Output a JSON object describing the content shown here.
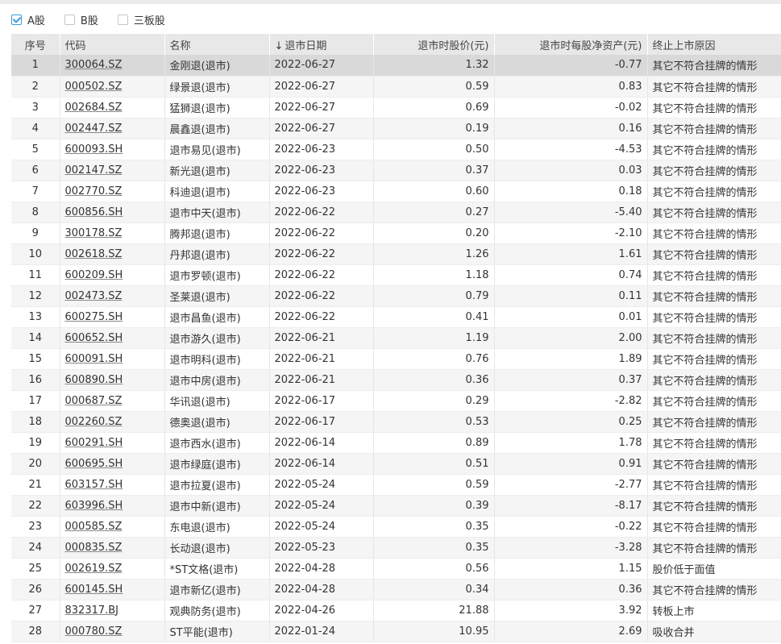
{
  "filters": [
    {
      "label": "A股",
      "checked": true
    },
    {
      "label": "B股",
      "checked": false
    },
    {
      "label": "三板股",
      "checked": false
    }
  ],
  "table": {
    "headers": {
      "seq": "序号",
      "code": "代码",
      "name": "名称",
      "date": "退市日期",
      "price": "退市时股价(元)",
      "nav": "退市时每股净资产(元)",
      "reason": "终止上市原因"
    },
    "sort_icon": "arrow-down-icon",
    "rows": [
      {
        "seq": "1",
        "code": "300064.SZ",
        "name": "金刚退(退市)",
        "date": "2022-06-27",
        "price": "1.32",
        "nav": "-0.77",
        "reason": "其它不符合挂牌的情形"
      },
      {
        "seq": "2",
        "code": "000502.SZ",
        "name": "绿景退(退市)",
        "date": "2022-06-27",
        "price": "0.59",
        "nav": "0.83",
        "reason": "其它不符合挂牌的情形"
      },
      {
        "seq": "3",
        "code": "002684.SZ",
        "name": "猛狮退(退市)",
        "date": "2022-06-27",
        "price": "0.69",
        "nav": "-0.02",
        "reason": "其它不符合挂牌的情形"
      },
      {
        "seq": "4",
        "code": "002447.SZ",
        "name": "晨鑫退(退市)",
        "date": "2022-06-27",
        "price": "0.19",
        "nav": "0.16",
        "reason": "其它不符合挂牌的情形"
      },
      {
        "seq": "5",
        "code": "600093.SH",
        "name": "退市易见(退市)",
        "date": "2022-06-23",
        "price": "0.50",
        "nav": "-4.53",
        "reason": "其它不符合挂牌的情形"
      },
      {
        "seq": "6",
        "code": "002147.SZ",
        "name": "新光退(退市)",
        "date": "2022-06-23",
        "price": "0.37",
        "nav": "0.03",
        "reason": "其它不符合挂牌的情形"
      },
      {
        "seq": "7",
        "code": "002770.SZ",
        "name": "科迪退(退市)",
        "date": "2022-06-23",
        "price": "0.60",
        "nav": "0.18",
        "reason": "其它不符合挂牌的情形"
      },
      {
        "seq": "8",
        "code": "600856.SH",
        "name": "退市中天(退市)",
        "date": "2022-06-22",
        "price": "0.27",
        "nav": "-5.40",
        "reason": "其它不符合挂牌的情形"
      },
      {
        "seq": "9",
        "code": "300178.SZ",
        "name": "腾邦退(退市)",
        "date": "2022-06-22",
        "price": "0.20",
        "nav": "-2.10",
        "reason": "其它不符合挂牌的情形"
      },
      {
        "seq": "10",
        "code": "002618.SZ",
        "name": "丹邦退(退市)",
        "date": "2022-06-22",
        "price": "1.26",
        "nav": "1.61",
        "reason": "其它不符合挂牌的情形"
      },
      {
        "seq": "11",
        "code": "600209.SH",
        "name": "退市罗顿(退市)",
        "date": "2022-06-22",
        "price": "1.18",
        "nav": "0.74",
        "reason": "其它不符合挂牌的情形"
      },
      {
        "seq": "12",
        "code": "002473.SZ",
        "name": "圣莱退(退市)",
        "date": "2022-06-22",
        "price": "0.79",
        "nav": "0.11",
        "reason": "其它不符合挂牌的情形"
      },
      {
        "seq": "13",
        "code": "600275.SH",
        "name": "退市昌鱼(退市)",
        "date": "2022-06-22",
        "price": "0.41",
        "nav": "0.01",
        "reason": "其它不符合挂牌的情形"
      },
      {
        "seq": "14",
        "code": "600652.SH",
        "name": "退市游久(退市)",
        "date": "2022-06-21",
        "price": "1.19",
        "nav": "2.00",
        "reason": "其它不符合挂牌的情形"
      },
      {
        "seq": "15",
        "code": "600091.SH",
        "name": "退市明科(退市)",
        "date": "2022-06-21",
        "price": "0.76",
        "nav": "1.89",
        "reason": "其它不符合挂牌的情形"
      },
      {
        "seq": "16",
        "code": "600890.SH",
        "name": "退市中房(退市)",
        "date": "2022-06-21",
        "price": "0.36",
        "nav": "0.37",
        "reason": "其它不符合挂牌的情形"
      },
      {
        "seq": "17",
        "code": "000687.SZ",
        "name": "华讯退(退市)",
        "date": "2022-06-17",
        "price": "0.29",
        "nav": "-2.82",
        "reason": "其它不符合挂牌的情形"
      },
      {
        "seq": "18",
        "code": "002260.SZ",
        "name": "德奥退(退市)",
        "date": "2022-06-17",
        "price": "0.53",
        "nav": "0.25",
        "reason": "其它不符合挂牌的情形"
      },
      {
        "seq": "19",
        "code": "600291.SH",
        "name": "退市西水(退市)",
        "date": "2022-06-14",
        "price": "0.89",
        "nav": "1.78",
        "reason": "其它不符合挂牌的情形"
      },
      {
        "seq": "20",
        "code": "600695.SH",
        "name": "退市绿庭(退市)",
        "date": "2022-06-14",
        "price": "0.51",
        "nav": "0.91",
        "reason": "其它不符合挂牌的情形"
      },
      {
        "seq": "21",
        "code": "603157.SH",
        "name": "退市拉夏(退市)",
        "date": "2022-05-24",
        "price": "0.59",
        "nav": "-2.77",
        "reason": "其它不符合挂牌的情形"
      },
      {
        "seq": "22",
        "code": "603996.SH",
        "name": "退市中新(退市)",
        "date": "2022-05-24",
        "price": "0.39",
        "nav": "-8.17",
        "reason": "其它不符合挂牌的情形"
      },
      {
        "seq": "23",
        "code": "000585.SZ",
        "name": "东电退(退市)",
        "date": "2022-05-24",
        "price": "0.35",
        "nav": "-0.22",
        "reason": "其它不符合挂牌的情形"
      },
      {
        "seq": "24",
        "code": "000835.SZ",
        "name": "长动退(退市)",
        "date": "2022-05-23",
        "price": "0.35",
        "nav": "-3.28",
        "reason": "其它不符合挂牌的情形"
      },
      {
        "seq": "25",
        "code": "002619.SZ",
        "name": "*ST文格(退市)",
        "date": "2022-04-28",
        "price": "0.56",
        "nav": "1.15",
        "reason": "股价低于面值"
      },
      {
        "seq": "26",
        "code": "600145.SH",
        "name": "退市新亿(退市)",
        "date": "2022-04-28",
        "price": "0.34",
        "nav": "0.36",
        "reason": "其它不符合挂牌的情形"
      },
      {
        "seq": "27",
        "code": "832317.BJ",
        "name": "观典防务(退市)",
        "date": "2022-04-26",
        "price": "21.88",
        "nav": "3.92",
        "reason": "转板上市"
      },
      {
        "seq": "28",
        "code": "000780.SZ",
        "name": "ST平能(退市)",
        "date": "2022-01-24",
        "price": "10.95",
        "nav": "2.69",
        "reason": "吸收合并"
      }
    ]
  }
}
